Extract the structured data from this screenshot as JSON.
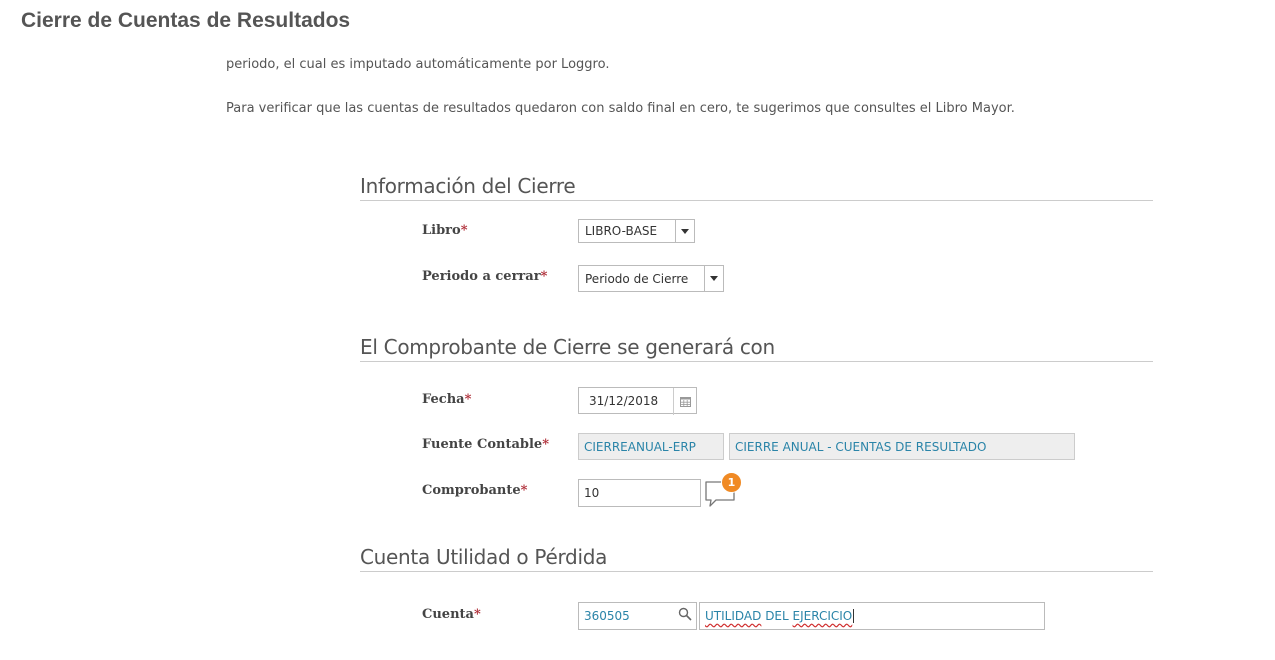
{
  "page": {
    "title": "Cierre de Cuentas de Resultados",
    "intro_line_1": "periodo, el cual es imputado automáticamente por Loggro.",
    "intro_line_2": "Para verificar que las cuentas de resultados quedaron con saldo final en cero, te sugerimos que consultes el Libro Mayor."
  },
  "info_cierre": {
    "title": "Información del Cierre",
    "libro": {
      "label": "Libro",
      "value": "LIBRO-BASE"
    },
    "periodo": {
      "label": "Periodo a cerrar",
      "value": "Periodo de Cierre"
    }
  },
  "comprobante_cierre": {
    "title": "El Comprobante de Cierre se generará con",
    "fecha": {
      "label": "Fecha",
      "value": "31/12/2018"
    },
    "fuente": {
      "label": "Fuente Contable",
      "code": "CIERREANUAL-ERP",
      "name": "CIERRE ANUAL - CUENTAS DE RESULTADO"
    },
    "comprobante": {
      "label": "Comprobante",
      "value": "10",
      "comment_badge": "1"
    }
  },
  "cuenta_utilidad": {
    "title": "Cuenta Utilidad o Pérdida",
    "cuenta": {
      "label": "Cuenta",
      "code": "360505",
      "name_word_1": "UTILIDAD",
      "name_word_2": "DEL",
      "name_word_3": "EJERCICIO"
    }
  },
  "required_marker": "*",
  "colors": {
    "required": "#b0303a",
    "link": "#2a84a8",
    "badge": "#f08a24"
  }
}
